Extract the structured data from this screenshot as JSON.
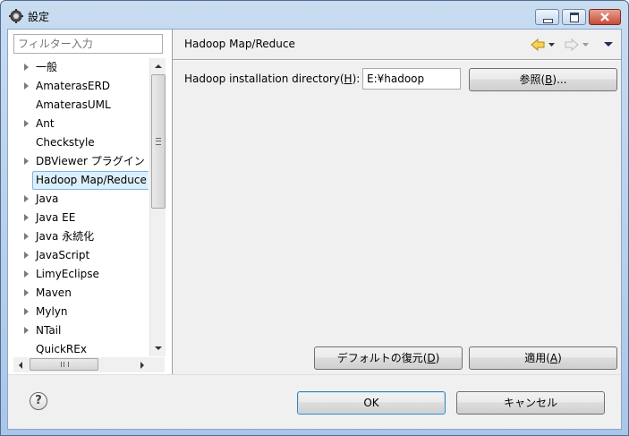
{
  "window": {
    "title": "設定",
    "accent": "#3c7fb1"
  },
  "filter": {
    "placeholder": "フィルター入力"
  },
  "tree": [
    {
      "label": "一般",
      "expandable": true
    },
    {
      "label": "AmaterasERD",
      "expandable": true
    },
    {
      "label": "AmaterasUML",
      "expandable": false
    },
    {
      "label": "Ant",
      "expandable": true
    },
    {
      "label": "Checkstyle",
      "expandable": false
    },
    {
      "label": "DBViewer プラグイン",
      "expandable": true
    },
    {
      "label": "Hadoop Map/Reduce",
      "expandable": false,
      "selected": true
    },
    {
      "label": "Java",
      "expandable": true
    },
    {
      "label": "Java EE",
      "expandable": true
    },
    {
      "label": "Java 永続化",
      "expandable": true
    },
    {
      "label": "JavaScript",
      "expandable": true
    },
    {
      "label": "LimyEclipse",
      "expandable": true
    },
    {
      "label": "Maven",
      "expandable": true
    },
    {
      "label": "Mylyn",
      "expandable": true
    },
    {
      "label": "NTail",
      "expandable": true
    },
    {
      "label": "QuickREx",
      "expandable": false
    }
  ],
  "page": {
    "title": "Hadoop Map/Reduce",
    "field_label": "Hadoop installation directory(H):",
    "field_value": "E:¥hadoop",
    "browse_label": "参照(B)..."
  },
  "buttons": {
    "restore_defaults": "デフォルトの復元(D)",
    "apply": "適用(A)",
    "ok": "OK",
    "cancel": "キャンセル"
  }
}
